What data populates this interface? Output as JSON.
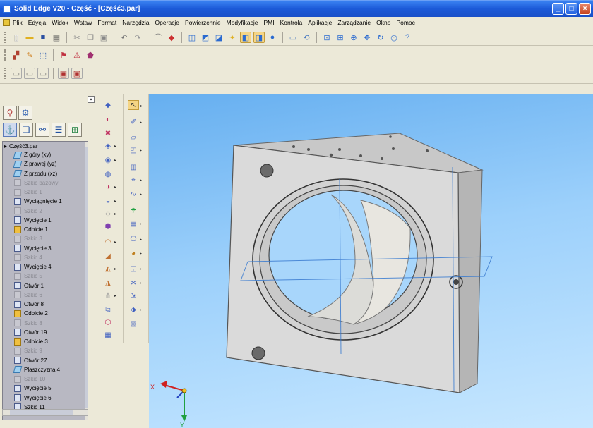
{
  "window": {
    "title": "Solid Edge V20 - Część - [Część3.par]",
    "buttons": {
      "minimize": "_",
      "maximize": "□",
      "close": "×"
    }
  },
  "menu": [
    "Plik",
    "Edycja",
    "Widok",
    "Wstaw",
    "Format",
    "Narzędzia",
    "Operacje",
    "Powierzchnie",
    "Modyfikacje",
    "PMI",
    "Kontrola",
    "Aplikacje",
    "Zarządzanie",
    "Okno",
    "Pomoc"
  ],
  "toolbars": {
    "standard": [
      "new-file-icon",
      "open-folder-icon",
      "save-icon",
      "print-icon",
      "cut-icon",
      "copy-icon",
      "paste-icon",
      "undo-icon",
      "redo-icon",
      "sketch-icon",
      "select-icon",
      "view-front-icon",
      "view-iso-icon",
      "view-top-icon",
      "light-icon",
      "shade-on-icon",
      "shade-visible-edges-icon",
      "render-sphere-icon",
      "display-icon",
      "rotate-icon",
      "fit-icon",
      "zoom-area-icon",
      "zoom-icon",
      "pan-icon",
      "spin-icon",
      "look-at-icon",
      "help-icon"
    ],
    "features": [
      "feature-library-icon",
      "part-painter-icon",
      "variables-icon",
      "constraint-icon",
      "mirror-icon",
      "physical-props-icon"
    ],
    "views": [
      "view-1-icon",
      "view-2-icon",
      "view-3-icon",
      "view-4-icon",
      "view-5-icon"
    ]
  },
  "pathfinder": {
    "close_label": "×",
    "root": "Część3.par",
    "items": [
      {
        "label": "Z góry (xy)",
        "ghost": false,
        "kind": "plane"
      },
      {
        "label": "Z prawej (yz)",
        "ghost": false,
        "kind": "plane"
      },
      {
        "label": "Z przodu (xz)",
        "ghost": false,
        "kind": "plane"
      },
      {
        "label": "Szkic bazowy",
        "ghost": true,
        "kind": "sketch"
      },
      {
        "label": "Szkic 1",
        "ghost": true,
        "kind": "sketch"
      },
      {
        "label": "Wyciągnięcie 1",
        "ghost": false,
        "kind": "feature"
      },
      {
        "label": "Szkic 2",
        "ghost": true,
        "kind": "sketch"
      },
      {
        "label": "Wycięcie 1",
        "ghost": false,
        "kind": "feature"
      },
      {
        "label": "Odbicie 1",
        "ghost": false,
        "kind": "mirror"
      },
      {
        "label": "Szkic 3",
        "ghost": true,
        "kind": "sketch"
      },
      {
        "label": "Wycięcie 3",
        "ghost": false,
        "kind": "feature"
      },
      {
        "label": "Szkic 4",
        "ghost": true,
        "kind": "sketch"
      },
      {
        "label": "Wycięcie 4",
        "ghost": false,
        "kind": "feature"
      },
      {
        "label": "Szkic 5",
        "ghost": true,
        "kind": "sketch"
      },
      {
        "label": "Otwór 1",
        "ghost": false,
        "kind": "feature"
      },
      {
        "label": "Szkic 6",
        "ghost": true,
        "kind": "sketch"
      },
      {
        "label": "Otwór 8",
        "ghost": false,
        "kind": "feature"
      },
      {
        "label": "Odbicie 2",
        "ghost": false,
        "kind": "mirror"
      },
      {
        "label": "Szkic 8",
        "ghost": true,
        "kind": "sketch"
      },
      {
        "label": "Otwór 19",
        "ghost": false,
        "kind": "feature"
      },
      {
        "label": "Odbicie 3",
        "ghost": false,
        "kind": "mirror"
      },
      {
        "label": "Szkic 9",
        "ghost": true,
        "kind": "sketch"
      },
      {
        "label": "Otwór 27",
        "ghost": false,
        "kind": "feature"
      },
      {
        "label": "Płaszczyzna 4",
        "ghost": false,
        "kind": "plane"
      },
      {
        "label": "Szkic 10",
        "ghost": true,
        "kind": "sketch"
      },
      {
        "label": "Wycięcie 5",
        "ghost": false,
        "kind": "feature"
      },
      {
        "label": "Wycięcie 6",
        "ghost": false,
        "kind": "feature"
      },
      {
        "label": "Szkic 11",
        "ghost": false,
        "kind": "sketch"
      }
    ]
  },
  "axes": {
    "x": "X",
    "y": "Y"
  },
  "colors": {
    "title_bar": "#1c5ad8",
    "viewport_top": "#66aff0",
    "viewport_bottom": "#c7e7ff",
    "part": "#d9d9d9",
    "tree_bg": "#b8b8c2"
  }
}
